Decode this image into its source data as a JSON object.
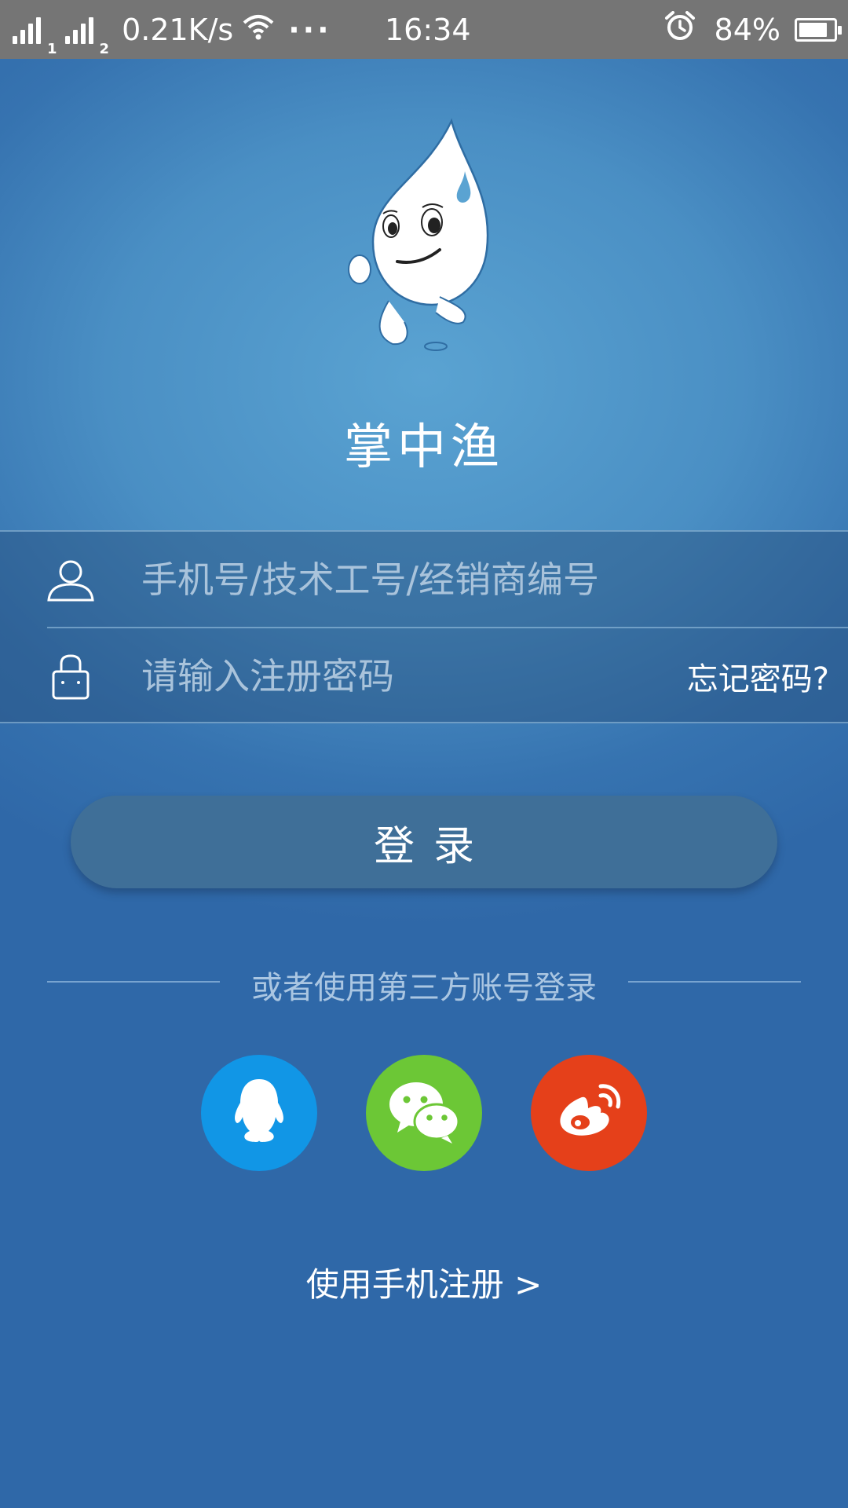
{
  "status_bar": {
    "sim1_label": "1",
    "sim2_label": "2",
    "net_speed": "0.21K/s",
    "more": "···",
    "time": "16:34",
    "battery_percent_text": "84%",
    "battery_level": 0.84,
    "icons": [
      "signal-icon",
      "wifi-icon",
      "alarm-icon",
      "battery-icon"
    ]
  },
  "app": {
    "name": "掌中渔"
  },
  "form": {
    "username_placeholder": "手机号/技术工号/经销商编号",
    "password_placeholder": "请输入注册密码",
    "forgot_password": "忘记密码?"
  },
  "login_button": "登录",
  "third_party": {
    "label": "或者使用第三方账号登录",
    "providers": [
      {
        "name": "QQ",
        "icon": "qq-icon",
        "color": "#1196e6"
      },
      {
        "name": "WeChat",
        "icon": "wechat-icon",
        "color": "#6cc736"
      },
      {
        "name": "Weibo",
        "icon": "weibo-icon",
        "color": "#e5401a"
      }
    ]
  },
  "register_link": "使用手机注册 >"
}
